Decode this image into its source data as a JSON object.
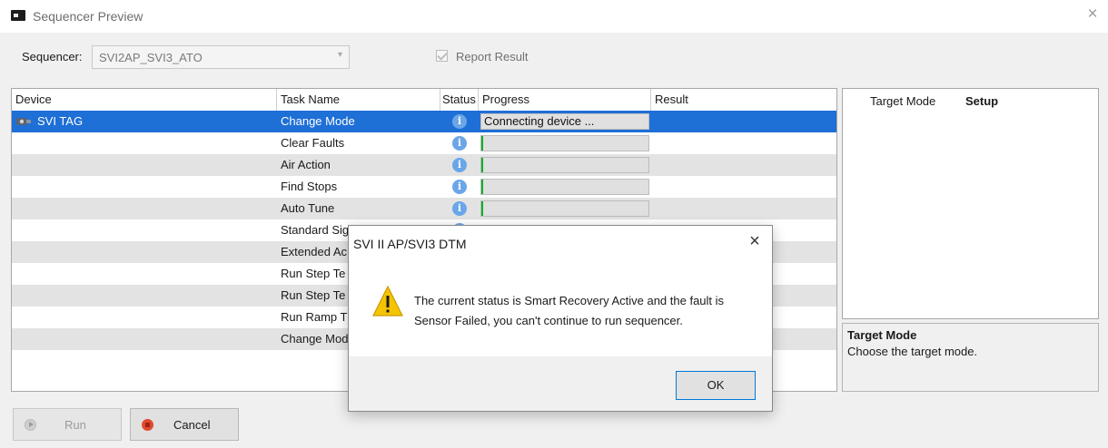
{
  "window": {
    "title": "Sequencer Preview",
    "close_glyph": "×"
  },
  "toolbar": {
    "sequencer_label": "Sequencer:",
    "sequencer_value": "SVI2AP_SVI3_ATO",
    "report_label": "Report Result",
    "report_checked": true
  },
  "grid": {
    "columns": [
      "Device",
      "Task Name",
      "Status",
      "Progress",
      "Result"
    ],
    "rows": [
      {
        "device": "SVI TAG",
        "task": "Change Mode",
        "status": "info",
        "progress_text": "Connecting device ...",
        "selected": true
      },
      {
        "device": "",
        "task": "Clear Faults",
        "status": "info",
        "progress": 0.01
      },
      {
        "device": "",
        "task": "Air Action",
        "status": "info",
        "progress": 0.01
      },
      {
        "device": "",
        "task": "Find Stops",
        "status": "info",
        "progress": 0.01
      },
      {
        "device": "",
        "task": "Auto Tune",
        "status": "info",
        "progress": 0.01
      },
      {
        "device": "",
        "task": "Standard Sig",
        "status": "info"
      },
      {
        "device": "",
        "task": "Extended Ac",
        "status": ""
      },
      {
        "device": "",
        "task": "Run Step Te",
        "status": ""
      },
      {
        "device": "",
        "task": "Run Step Te",
        "status": ""
      },
      {
        "device": "",
        "task": "Run Ramp T",
        "status": ""
      },
      {
        "device": "",
        "task": "Change Mod",
        "status": ""
      }
    ]
  },
  "target_panel": {
    "key": "Target Mode",
    "value": "Setup"
  },
  "description": {
    "title": "Target Mode",
    "text": "Choose the target mode."
  },
  "buttons": {
    "run": "Run",
    "cancel": "Cancel"
  },
  "dialog": {
    "title": "SVI II AP/SVI3 DTM",
    "close_glyph": "×",
    "message": "The current status is Smart Recovery Active and the fault is\nSensor Failed, you can't continue to run sequencer.",
    "ok": "OK"
  },
  "colors": {
    "selection": "#1e6fd6",
    "progress_fill": "#06b025",
    "dialog_focus": "#0078d7",
    "warning": "#f5c400"
  }
}
